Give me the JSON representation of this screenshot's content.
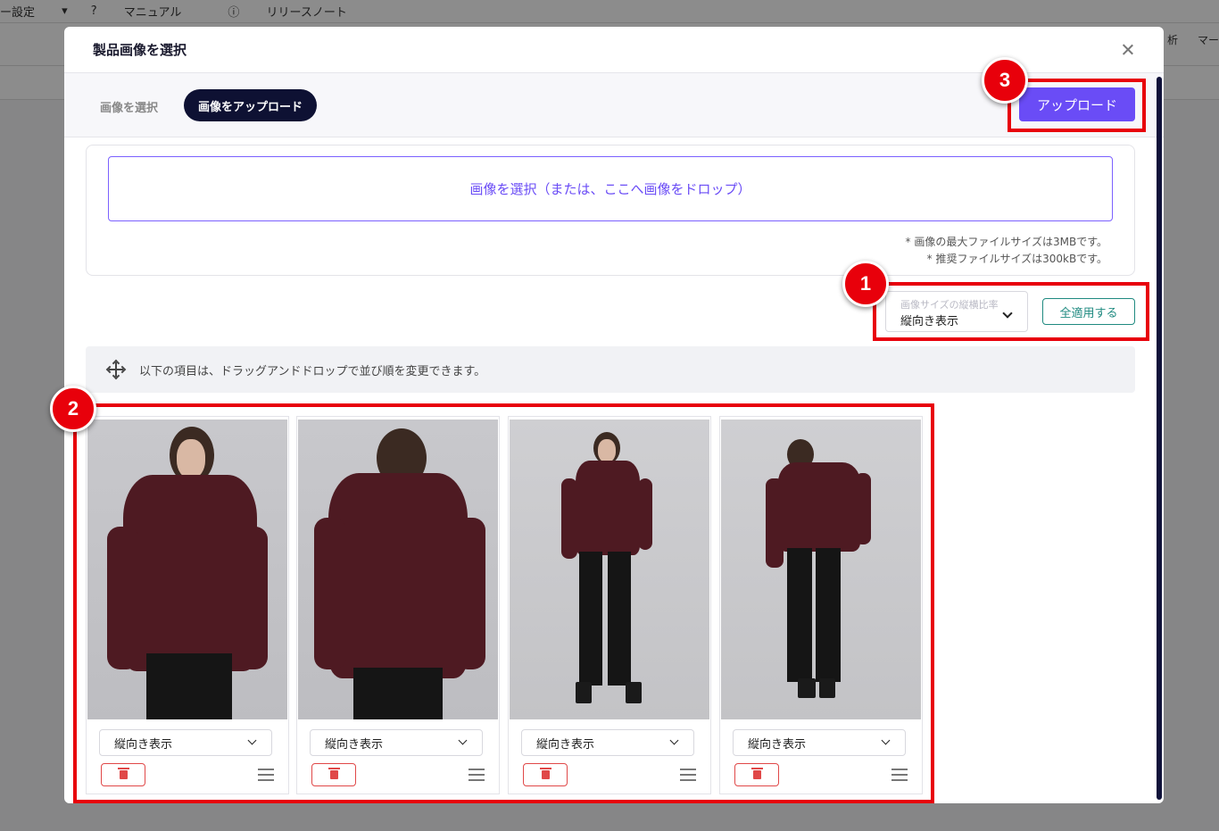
{
  "background": {
    "topbar_items": [
      "ー設定",
      "マニュアル",
      "リリースノート"
    ],
    "right_items": [
      "析",
      "マー"
    ]
  },
  "modal": {
    "title": "製品画像を選択",
    "tabs": [
      {
        "label": "画像を選択",
        "active": false
      },
      {
        "label": "画像をアップロード",
        "active": true
      }
    ],
    "upload_button": "アップロード",
    "drop_zone_text": "画像を選択（または、ここへ画像をドロップ）",
    "notes": [
      "* 画像の最大ファイルサイズは3MBです。",
      "* 推奨ファイルサイズは300kBです。"
    ],
    "aspect_ratio": {
      "label": "画像サイズの縦横比率",
      "value": "縦向き表示"
    },
    "apply_all_button": "全適用する",
    "drag_info": "以下の項目は、ドラッグアンドドロップで並び順を変更できます。",
    "images": [
      {
        "orientation": "縦向き表示",
        "pose": "front-half"
      },
      {
        "orientation": "縦向き表示",
        "pose": "back-half"
      },
      {
        "orientation": "縦向き表示",
        "pose": "front-full"
      },
      {
        "orientation": "縦向き表示",
        "pose": "back-full"
      }
    ]
  },
  "annotations": [
    "1",
    "2",
    "3"
  ],
  "colors": {
    "accent": "#6a4cf6",
    "tab_active_bg": "#0e1133",
    "apply": "#1f8a80",
    "delete": "#e04848",
    "annotation": "#e8000b",
    "sweater": "#4e1a22"
  }
}
